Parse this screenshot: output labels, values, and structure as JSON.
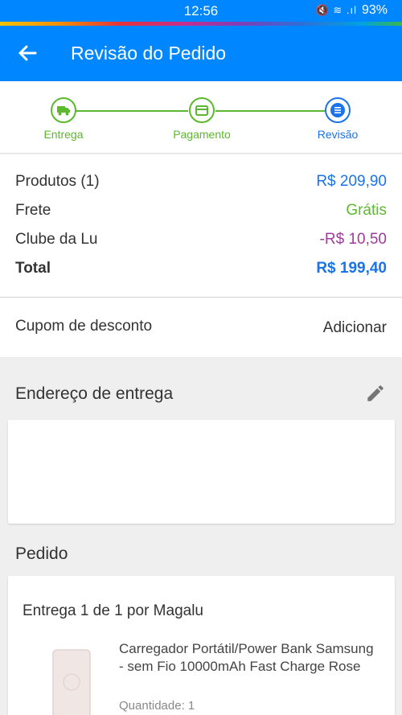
{
  "status_bar": {
    "time": "12:56",
    "battery": "93%"
  },
  "app_bar": {
    "title": "Revisão do Pedido"
  },
  "steps": [
    {
      "label": "Entrega",
      "icon": "truck-icon",
      "color": "#5cb82e"
    },
    {
      "label": "Pagamento",
      "icon": "credit-card-icon",
      "color": "#5cb82e"
    },
    {
      "label": "Revisão",
      "icon": "review-list-icon",
      "color": "#1a73e8"
    }
  ],
  "summary": {
    "products_label": "Produtos (1)",
    "products_value": "R$ 209,90",
    "shipping_label": "Frete",
    "shipping_value": "Grátis",
    "club_label": "Clube da Lu",
    "club_value": "-R$ 10,50",
    "total_label": "Total",
    "total_value": "R$ 199,40"
  },
  "coupon": {
    "label": "Cupom de desconto",
    "action": "Adicionar"
  },
  "address": {
    "title": "Endereço de entrega"
  },
  "order": {
    "title": "Pedido",
    "delivery_label": "Entrega 1 de 1 por Magalu",
    "product_name": "Carregador Portátil/Power Bank Samsung - sem Fio 10000mAh Fast Charge Rose",
    "quantity": "Quantidade:  1"
  },
  "colors": {
    "primary": "#0086ff",
    "price_blue": "#1a73e8",
    "green": "#5cb82e",
    "discount_purple": "#a03c9c"
  }
}
